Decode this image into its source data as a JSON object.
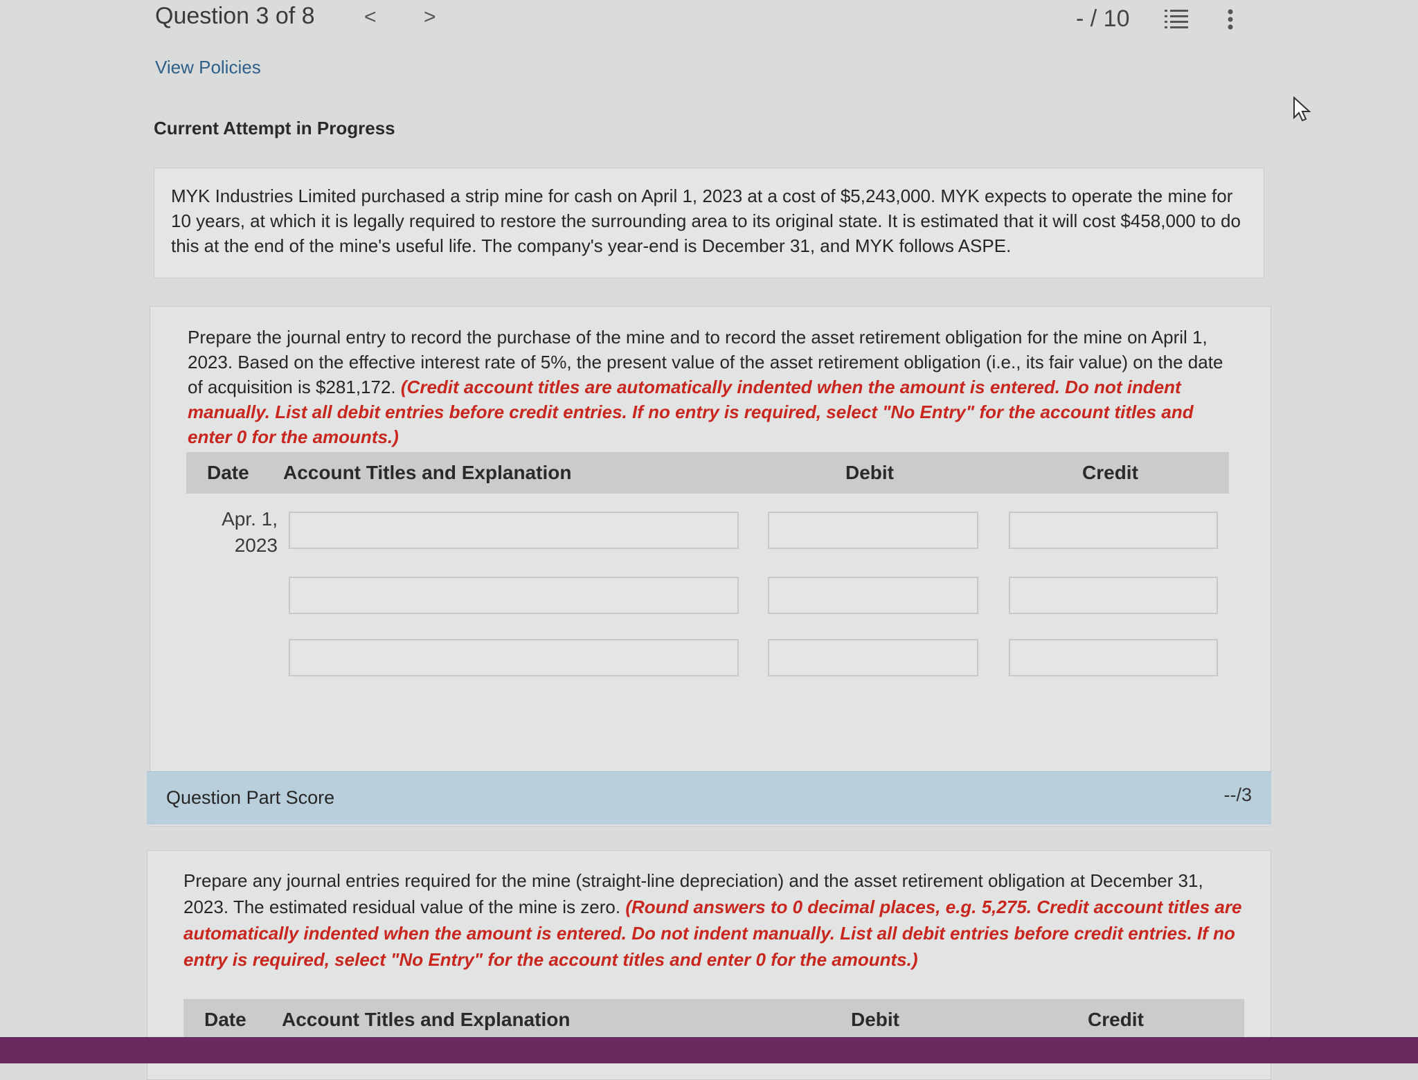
{
  "header": {
    "question_title": "Question 3 of 8",
    "prev_icon": "<",
    "next_icon": ">",
    "score": "- / 10",
    "list_icon": "list-icon",
    "more_icon": "more-vertical-icon"
  },
  "view_policies": "View Policies",
  "attempt_status": "Current Attempt in Progress",
  "problem": "MYK Industries Limited purchased a strip mine for cash on April 1, 2023 at a cost of $5,243,000. MYK expects to operate the mine for 10 years, at which it is legally required to restore the surrounding area to its original state. It is estimated that it will cost $458,000 to do this at the end of the mine's useful life. The company's year-end is December 31, and MYK follows ASPE.",
  "part1": {
    "instructions": "Prepare the journal entry to record the purchase of the mine and to record the asset retirement obligation for the mine on April 1, 2023. Based on the effective interest rate of 5%, the present value of the asset retirement obligation (i.e., its fair value) on the date of acquisition is $281,172.",
    "note": "(Credit account titles are automatically indented when the amount is entered. Do not indent manually. List all debit entries before credit entries. If no entry is required, select \"No Entry\" for the account titles and enter 0 for the amounts.)",
    "table": {
      "headers": {
        "date": "Date",
        "account": "Account Titles and Explanation",
        "debit": "Debit",
        "credit": "Credit"
      },
      "date_line1": "Apr. 1,",
      "date_line2": "2023",
      "rows": [
        {
          "account": "",
          "debit": "",
          "credit": ""
        },
        {
          "account": "",
          "debit": "",
          "credit": ""
        },
        {
          "account": "",
          "debit": "",
          "credit": ""
        }
      ]
    }
  },
  "part_score": {
    "label": "Question Part Score",
    "value": "--/3"
  },
  "part2": {
    "instructions": "Prepare any journal entries required for the mine (straight-line depreciation) and the asset retirement obligation at December 31, 2023. The estimated residual value of the mine is zero.",
    "note": "(Round answers to 0 decimal places, e.g. 5,275. Credit account titles are automatically indented when the amount is entered. Do not indent manually. List all debit entries before credit entries. If no entry is required, select \"No Entry\" for the account titles and enter 0 for the amounts.)",
    "table": {
      "headers": {
        "date": "Date",
        "account": "Account Titles and Explanation",
        "debit": "Debit",
        "credit": "Credit"
      }
    }
  },
  "colors": {
    "link": "#2e5f8a",
    "warning": "#c8261f",
    "score_bar": "#b9cfdb",
    "taskbar": "#6b2a5e"
  }
}
